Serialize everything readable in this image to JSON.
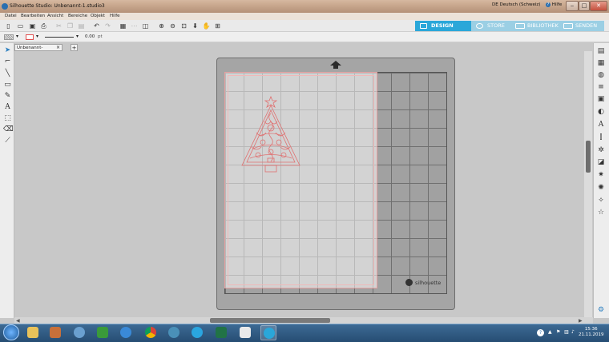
{
  "window": {
    "title": "Silhouette Studio: Unbenannt-1.studio3",
    "language": "DE Deutsch (Schweiz)",
    "help": "Hilfe",
    "controls": [
      "‒",
      "□",
      "✕"
    ]
  },
  "menu": [
    "Datei",
    "Bearbeiten",
    "Ansicht",
    "Bereiche",
    "Objekt",
    "Hilfe"
  ],
  "nav_tabs": {
    "design": "DESIGN",
    "store": "STORE",
    "library": "BIBLIOTHEK",
    "send": "SENDEN"
  },
  "propbar": {
    "line_width": "0.00",
    "unit": "pt"
  },
  "document": {
    "tab_label": "Unbenannt-1.studio3",
    "add_tab": "+"
  },
  "mat": {
    "brand": "silhouette"
  },
  "colors": {
    "accent": "#2aa7d9",
    "cut_line": "#e07070",
    "mat": "#a5a5a5"
  },
  "clock": {
    "time": "15:36",
    "date": "21.11.2019"
  }
}
